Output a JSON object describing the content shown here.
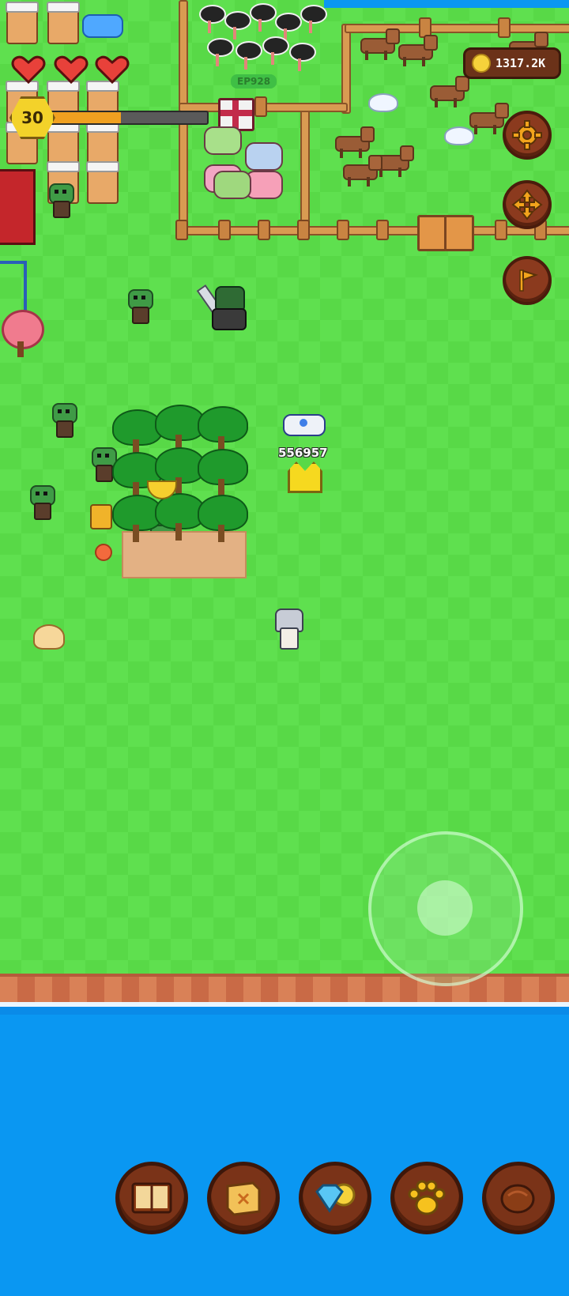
{
  "hud": {
    "level": "30",
    "xp_progress": 0.45,
    "hearts": 3,
    "coins": "1317.2K"
  },
  "world": {
    "plot_label": "EP928",
    "damage_number": "556957"
  },
  "side_buttons": [
    {
      "icon": "settings-gear-icon"
    },
    {
      "icon": "move-arrows-icon"
    },
    {
      "icon": "flag-icon"
    }
  ],
  "bottom_menu": [
    {
      "icon": "book-icon"
    },
    {
      "icon": "map-scroll-icon"
    },
    {
      "icon": "gem-coin-shop-icon"
    },
    {
      "icon": "paw-pets-icon"
    },
    {
      "icon": "meat-food-icon"
    }
  ],
  "colors": {
    "grass": "#5fe04f",
    "sea": "#0a97f2",
    "button_brown": "#8b3a1e",
    "coin_gold": "#f6d23b"
  }
}
